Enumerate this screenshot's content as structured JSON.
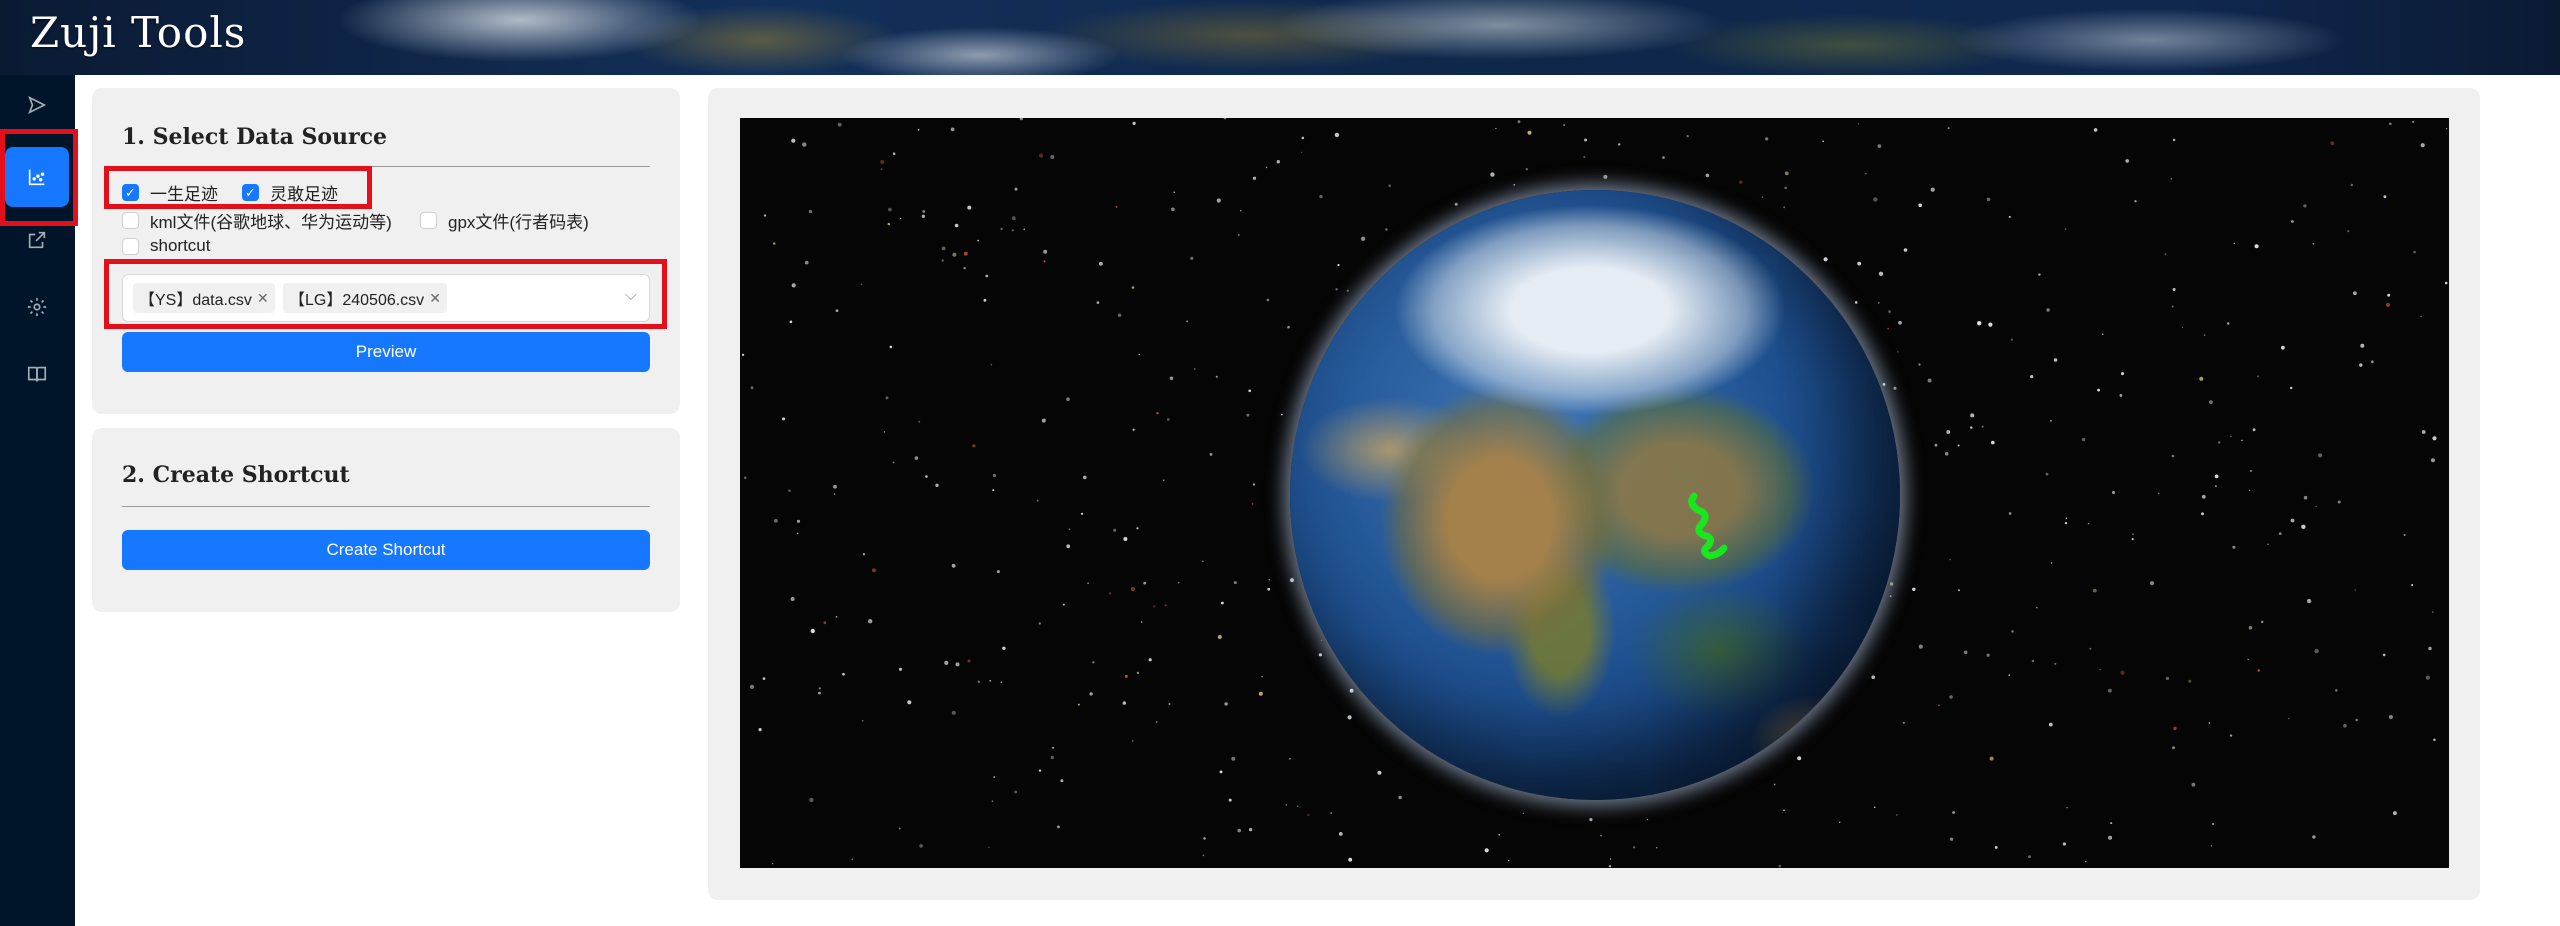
{
  "app": {
    "title": "Zuji Tools"
  },
  "sidebar": {
    "items": [
      {
        "name": "send-icon",
        "active": false
      },
      {
        "name": "chart-icon",
        "active": true
      },
      {
        "name": "export-icon",
        "active": false
      },
      {
        "name": "gear-icon",
        "active": false
      },
      {
        "name": "book-icon",
        "active": false
      }
    ]
  },
  "section1": {
    "title": "1. Select Data Source",
    "options": [
      {
        "label": "一生足迹",
        "checked": true
      },
      {
        "label": "灵敢足迹",
        "checked": true
      },
      {
        "label": "kml文件(谷歌地球、华为运动等)",
        "checked": false
      },
      {
        "label": "gpx文件(行者码表)",
        "checked": false
      },
      {
        "label": "shortcut",
        "checked": false
      }
    ],
    "selected_files": [
      "【YS】data.csv",
      "【LG】240506.csv"
    ],
    "preview_button": "Preview"
  },
  "section2": {
    "title": "2. Create Shortcut",
    "create_button": "Create Shortcut"
  },
  "colors": {
    "accent": "#1677ff",
    "sidebar_bg": "#001529",
    "highlight_border": "#e3101c",
    "route": "#19e61e"
  }
}
